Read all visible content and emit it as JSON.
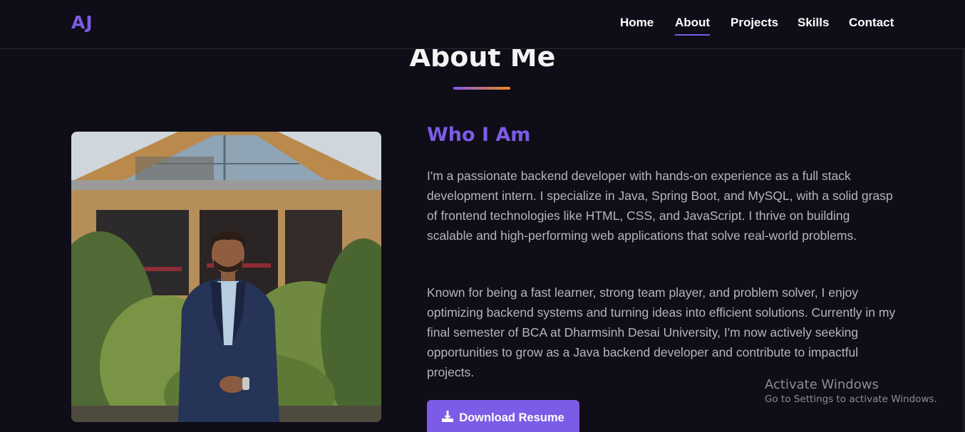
{
  "navbar": {
    "logo": "AJ",
    "links": [
      {
        "label": "Home",
        "active": false
      },
      {
        "label": "About",
        "active": true
      },
      {
        "label": "Projects",
        "active": false
      },
      {
        "label": "Skills",
        "active": false
      },
      {
        "label": "Contact",
        "active": false
      }
    ]
  },
  "about": {
    "title": "About Me",
    "heading": "Who I Am",
    "paragraphs": [
      "I'm a passionate backend developer with hands-on experience as a full stack development intern. I specialize in Java, Spring Boot, and MySQL, with a solid grasp of frontend technologies like HTML, CSS, and JavaScript. I thrive on building scalable and high-performing web applications that solve real-world problems.",
      "Known for being a fast learner, strong team player, and problem solver, I enjoy optimizing backend systems and turning ideas into efficient solutions. Currently in my final semester of BCA at Dharmsinh Desai University, I'm now actively seeking opportunities to grow as a Java backend developer and contribute to impactful projects."
    ],
    "button_label": "Download Resume",
    "button_icon": "download-icon"
  },
  "watermark": {
    "title": "Activate Windows",
    "subtitle": "Go to Settings to activate Windows."
  },
  "colors": {
    "background": "#0f0d17",
    "accent": "#7c5ce6",
    "accent_secondary": "#f2871d",
    "body_text": "#b6b4be"
  }
}
